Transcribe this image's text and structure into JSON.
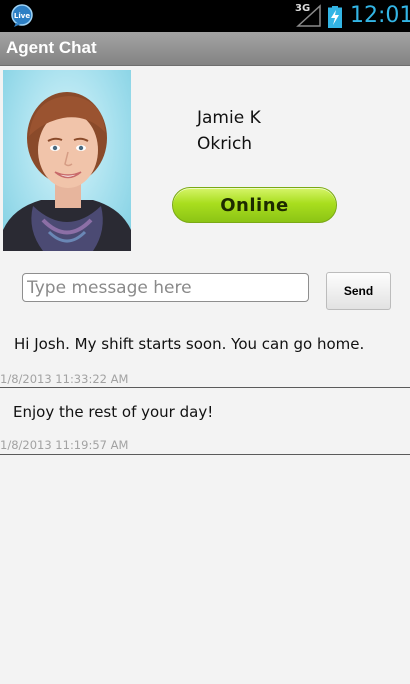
{
  "status_bar": {
    "network_label": "3G",
    "time": "12:01",
    "app_icon_text": "Live"
  },
  "title_bar": {
    "title": "Agent Chat"
  },
  "agent": {
    "first_name": "Jamie K",
    "last_name": "Okrich",
    "status": "Online",
    "status_color": "#a9de1e"
  },
  "composer": {
    "placeholder": "Type message here",
    "value": "",
    "send_label": "Send"
  },
  "messages": [
    {
      "text": "Hi Josh. My shift starts soon. You can go home.",
      "timestamp": "1/8/2013 11:33:22 AM"
    },
    {
      "text": "Enjoy the rest of your day!",
      "timestamp": "1/8/2013 11:19:57 AM"
    }
  ],
  "colors": {
    "clock": "#33b5e5",
    "title_bar": "#939393",
    "background": "#f3f3f3"
  }
}
